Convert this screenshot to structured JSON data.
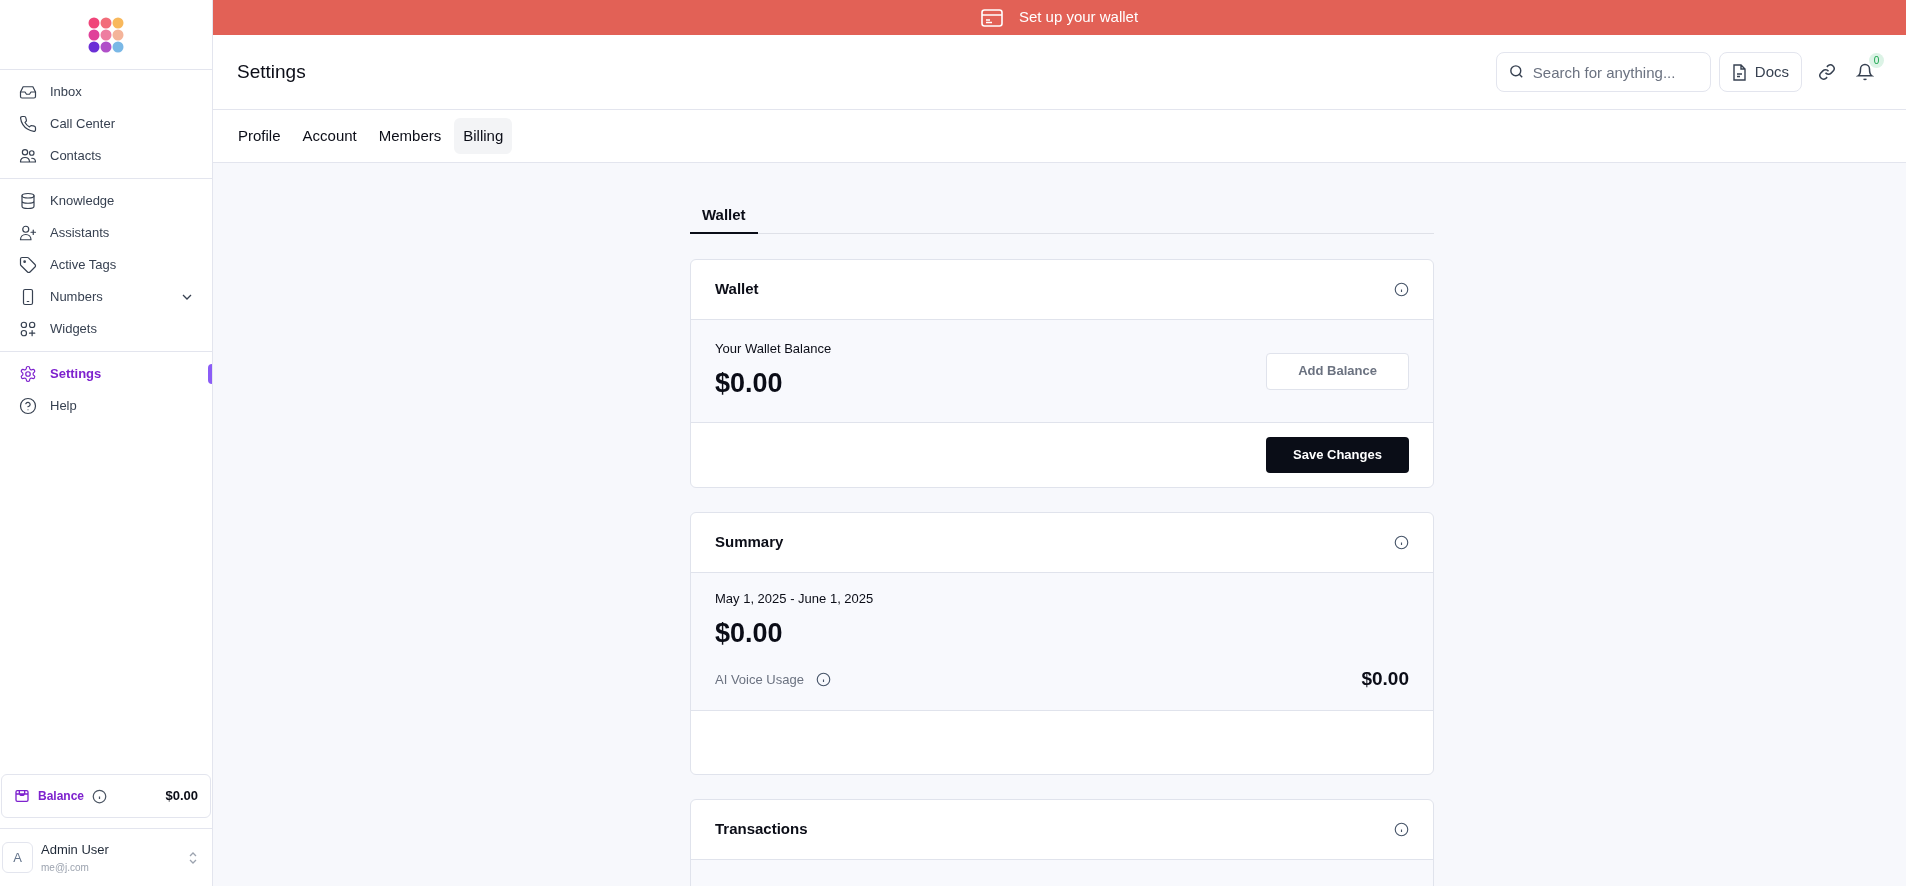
{
  "banner": {
    "text": "Set up your wallet"
  },
  "sidebar": {
    "sections": [
      {
        "items": [
          {
            "label": "Inbox",
            "kind": "link",
            "selected": false
          },
          {
            "label": "Call Center",
            "kind": "link",
            "selected": false
          },
          {
            "label": "Contacts",
            "kind": "link",
            "selected": false
          }
        ]
      },
      {
        "items": [
          {
            "label": "Knowledge",
            "kind": "link",
            "selected": false
          },
          {
            "label": "Assistants",
            "kind": "link",
            "selected": false
          },
          {
            "label": "Active Tags",
            "kind": "link",
            "selected": false
          },
          {
            "label": "Numbers",
            "kind": "group",
            "selected": false
          },
          {
            "label": "Widgets",
            "kind": "link",
            "selected": false
          }
        ]
      },
      {
        "items": [
          {
            "label": "Settings",
            "kind": "link",
            "selected": true
          },
          {
            "label": "Help",
            "kind": "link",
            "selected": false
          }
        ]
      }
    ],
    "balance": {
      "label": "Balance",
      "amount": "$0.00"
    },
    "user": {
      "avatar": "A",
      "name": "Admin User",
      "email": "me@j.com"
    }
  },
  "header": {
    "title": "Settings",
    "search": {
      "placeholder": "Search for anything..."
    },
    "docs": "Docs",
    "notifications": "0"
  },
  "tabs": [
    {
      "label": "Profile",
      "selected": false
    },
    {
      "label": "Account",
      "selected": false
    },
    {
      "label": "Members",
      "selected": false
    },
    {
      "label": "Billing",
      "selected": true
    }
  ],
  "subtabs": [
    {
      "label": "Wallet",
      "selected": true
    }
  ],
  "wallet_card": {
    "title": "Wallet",
    "balance_label": "Your Wallet Balance",
    "balance": "$0.00",
    "add_button": "Add Balance",
    "save_button": "Save Changes"
  },
  "summary_card": {
    "title": "Summary",
    "period": "May 1, 2025 - June 1, 2025",
    "total": "$0.00",
    "line_label": "AI Voice Usage",
    "line_amount": "$0.00"
  },
  "transactions_card": {
    "title": "Transactions"
  }
}
